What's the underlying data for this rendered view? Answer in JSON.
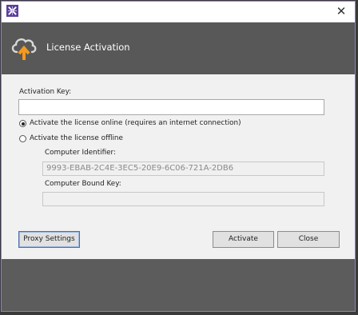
{
  "window": {
    "close_glyph": "✕"
  },
  "header": {
    "title": "License Activation"
  },
  "form": {
    "activation_key_label": "Activation Key:",
    "activation_key_value": "",
    "online_option": "Activate the license online (requires an internet connection)",
    "offline_option": "Activate the license offline",
    "online_selected": true,
    "computer_identifier_label": "Computer Identifier:",
    "computer_identifier_value": "9993-EBAB-2C4E-3EC5-20E9-6C06-721A-2DB6",
    "computer_bound_key_label": "Computer Bound Key:",
    "computer_bound_key_value": ""
  },
  "buttons": {
    "proxy_settings": "Proxy Settings",
    "activate": "Activate",
    "close": "Close"
  },
  "colors": {
    "header_bg": "#585858",
    "accent_orange": "#f39a1e",
    "window_border": "#9a7cc7"
  },
  "icons": {
    "app": "app-logo-icon",
    "header": "cloud-upload-icon",
    "close": "close-icon"
  }
}
